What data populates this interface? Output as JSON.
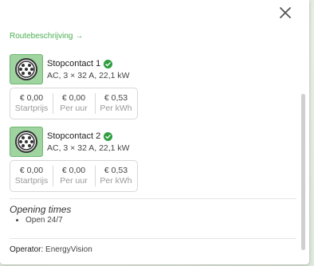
{
  "route_label": "Routebeschrijving →",
  "connectors": [
    {
      "title": "Stopcontact 1",
      "spec": "AC, 3 × 32 A, 22,1 kW",
      "prices": [
        {
          "value": "€ 0,00",
          "label": "Startprijs"
        },
        {
          "value": "€ 0,00",
          "label": "Per uur"
        },
        {
          "value": "€ 0,53",
          "label": "Per kWh"
        }
      ]
    },
    {
      "title": "Stopcontact 2",
      "spec": "AC, 3 × 32 A, 22,1 kW",
      "prices": [
        {
          "value": "€ 0,00",
          "label": "Startprijs"
        },
        {
          "value": "€ 0,00",
          "label": "Per uur"
        },
        {
          "value": "€ 0,53",
          "label": "Per kWh"
        }
      ]
    }
  ],
  "opening_times": {
    "title": "Opening times",
    "items": [
      "Open 24/7"
    ]
  },
  "operator": {
    "label": "Operator:",
    "value": "EnergyVision"
  },
  "colors": {
    "accent": "#4caf50",
    "status_ok": "#2e9e3e",
    "connector_bg": "#9fd3a0"
  },
  "icons": [
    "close-icon",
    "connector-type2-icon",
    "check-circle-icon"
  ]
}
